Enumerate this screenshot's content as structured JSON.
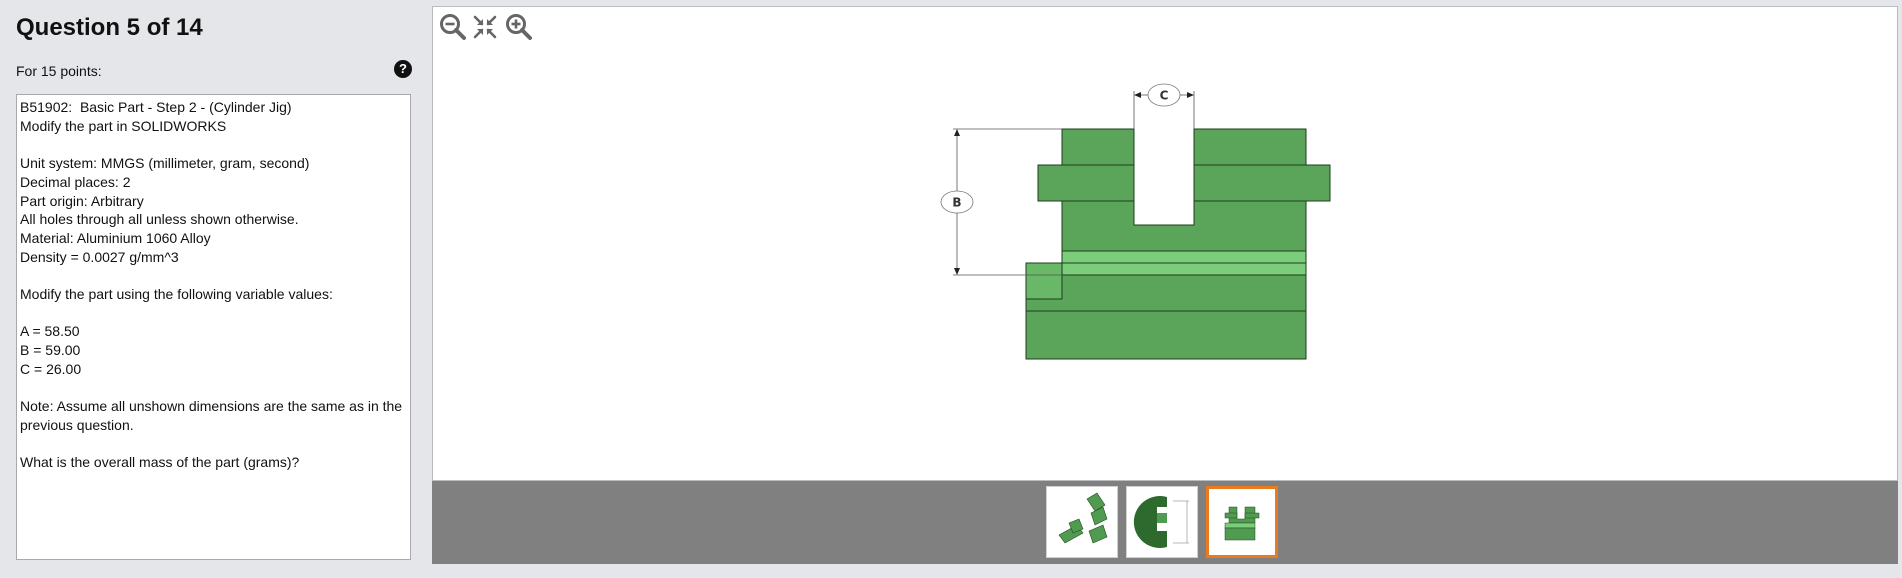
{
  "question": {
    "title": "Question 5 of 14",
    "points": "For 15 points:",
    "help_icon": "question-circle-icon",
    "body": "B51902:  Basic Part - Step 2 - (Cylinder Jig)\nModify the part in SOLIDWORKS\n\nUnit system: MMGS (millimeter, gram, second)\nDecimal places: 2\nPart origin: Arbitrary\nAll holes through all unless shown otherwise.\nMaterial: Aluminium 1060 Alloy\nDensity = 0.0027 g/mm^3\n\nModify the part using the following variable values:\n\nA = 58.50\nB = 59.00\nC = 26.00\n\nNote: Assume all unshown dimensions are the same as in the previous question.\n\nWhat is the overall mass of the part (grams)?"
  },
  "viewer": {
    "zoom_tools": [
      "zoom-out-icon",
      "fit-to-window-icon",
      "zoom-in-icon"
    ],
    "dimension_labels": {
      "b": "B",
      "c": "C"
    },
    "part_color": "#5aa55a",
    "part_light": "#7bcc7b",
    "part_dark": "#1e3d1e"
  },
  "thumbnails": [
    {
      "name": "isometric-view",
      "selected": false
    },
    {
      "name": "section-view",
      "selected": false
    },
    {
      "name": "front-view",
      "selected": true
    }
  ],
  "colors": {
    "selected_border": "#e97a1f",
    "strip_bg": "#808080"
  }
}
